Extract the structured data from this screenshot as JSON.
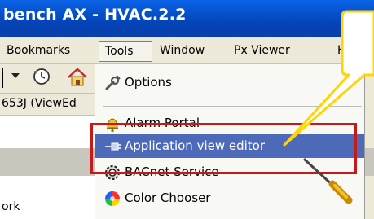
{
  "window": {
    "title": "bench AX - HVAC.2.2"
  },
  "menubar": {
    "items": [
      "Bookmarks",
      "Tools",
      "Window",
      "Px Viewer",
      "Help"
    ]
  },
  "left_pane": {
    "path_text": "653J (ViewEd",
    "bottom_text": "ork"
  },
  "tools_menu": {
    "items": [
      {
        "label": "Options",
        "icon": "wrench-icon"
      },
      {
        "label": "Alarm Portal",
        "icon": "bell-icon"
      },
      {
        "label": "Application view editor",
        "icon": "connector-icon",
        "highlighted": true
      },
      {
        "label": "BACnet Service",
        "icon": "gear-icon"
      },
      {
        "label": "Color Chooser",
        "icon": "color-wheel-icon"
      }
    ]
  },
  "colors": {
    "title_bar": "#0444b9",
    "menu_highlight": "#4d6ab8",
    "annotation_box": "#c41a1a",
    "callout": "#ffd400"
  }
}
